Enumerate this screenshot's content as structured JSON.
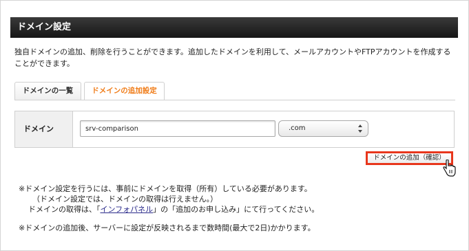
{
  "header": {
    "title": "ドメイン設定"
  },
  "intro": "独自ドメインの追加、削除を行うことができます。追加したドメインを利用して、メールアカウントやFTPアカウントを作成することができます。",
  "tabs": [
    {
      "label": "ドメインの一覧",
      "active": false
    },
    {
      "label": "ドメインの追加設定",
      "active": true
    }
  ],
  "form": {
    "label": "ドメイン",
    "domain_value": "srv-comparison",
    "tld_selected": ".com"
  },
  "confirm_button": "ドメインの追加（確認）",
  "notes": {
    "line1": "※ドメイン設定を行うには、事前にドメインを取得（所有）している必要があります。",
    "line2": "（ドメイン設定では、ドメインの取得は行えません。）",
    "line3_prefix": "ドメインの取得は、「",
    "line3_link": "インフォパネル",
    "line3_suffix": "」の「追加のお申し込み」にて行ってください。",
    "line4": "※ドメインの追加後、サーバーに設定が反映されるまで数時間(最大で2日)かかります。"
  },
  "colors": {
    "accent": "#f07d1a",
    "highlight_border": "#e8361c",
    "header_bg": "#1f1f1f"
  }
}
